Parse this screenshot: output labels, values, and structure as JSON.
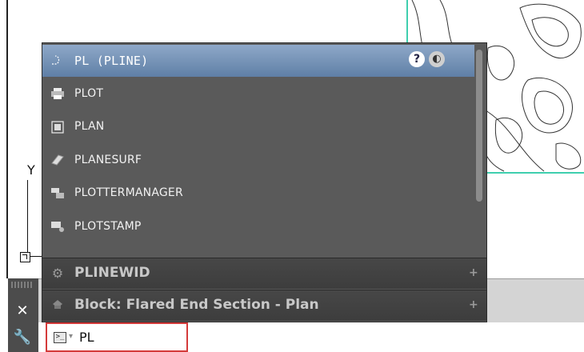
{
  "autocomplete": {
    "selected": {
      "label": "PL (PLINE)",
      "icon": "polyline-icon"
    },
    "items": [
      {
        "label": "PLOT",
        "icon": "plot-printer-icon"
      },
      {
        "label": "PLAN",
        "icon": "plan-view-icon"
      },
      {
        "label": "PLANESURF",
        "icon": "planar-surface-icon"
      },
      {
        "label": "PLOTTERMANAGER",
        "icon": "plotter-manager-icon"
      },
      {
        "label": "PLOTSTAMP",
        "icon": "plot-stamp-icon"
      }
    ],
    "sections": [
      {
        "label": "PLINEWID",
        "icon": "system-variable-gear-icon"
      },
      {
        "label": "Block: Flared End Section - Plan",
        "icon": "block-icon"
      }
    ]
  },
  "command_line": {
    "input_value": "PL"
  },
  "drawing": {
    "ucs_label": "Y"
  },
  "colors": {
    "popup_bg": "#5a5a5a",
    "selected_bg": "#6f8db3",
    "highlight_border": "#d43b3b",
    "viewport_border": "#3fcfae"
  }
}
